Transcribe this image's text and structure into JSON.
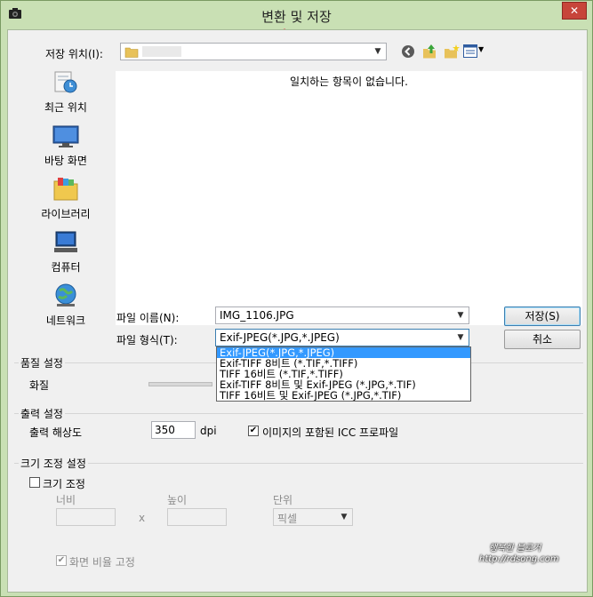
{
  "window": {
    "title": "변환 및 저장",
    "close": "✕"
  },
  "save_location": {
    "label": "저장 위치(I):",
    "value": ""
  },
  "file_list": {
    "empty_message": "일치하는 항목이 없습니다."
  },
  "places": [
    {
      "label": "최근 위치",
      "icon": "recent-places-icon"
    },
    {
      "label": "바탕 화면",
      "icon": "desktop-icon"
    },
    {
      "label": "라이브러리",
      "icon": "libraries-icon"
    },
    {
      "label": "컴퓨터",
      "icon": "computer-icon"
    },
    {
      "label": "네트워크",
      "icon": "network-icon"
    }
  ],
  "file_name": {
    "label": "파일 이름(N):",
    "value": "IMG_1106.JPG"
  },
  "file_type": {
    "label": "파일 형식(T):",
    "value": "Exif-JPEG(*.JPG,*.JPEG)",
    "options": [
      "Exif-JPEG(*.JPG,*.JPEG)",
      "Exif-TIFF 8비트 (*.TIF,*.TIFF)",
      "TIFF 16비트 (*.TIF,*.TIFF)",
      "Exif-TIFF 8비트 및 Exif-JPEG (*.JPG,*.TIF)",
      "TIFF 16비트 및 Exif-JPEG (*.JPG,*.TIF)"
    ],
    "selected_index": 0
  },
  "buttons": {
    "save": "저장(S)",
    "cancel": "취소"
  },
  "quality": {
    "group": "품질 설정",
    "label": "화질"
  },
  "output": {
    "group": "출력 설정",
    "resolution_label": "출력 해상도",
    "resolution_value": "350",
    "unit": "dpi",
    "icc_label": "이미지의 포함된 ICC 프로파일",
    "icc_checked": true
  },
  "resize": {
    "group": "크기 조정 설정",
    "resize_label": "크기 조정",
    "resize_checked": false,
    "width_label": "너비",
    "height_label": "높이",
    "times": "x",
    "unit_label": "단위",
    "unit_value": "픽셀",
    "aspect_label": "화면 비율 고정",
    "aspect_checked": true
  },
  "watermark": {
    "line1": "행복한 블로거",
    "line2": "http://rdsong.com"
  },
  "colors": {
    "frame": "#c9e0b4",
    "accent": "#3399ff",
    "close": "#c7453a",
    "arrow": "#e0606a"
  }
}
